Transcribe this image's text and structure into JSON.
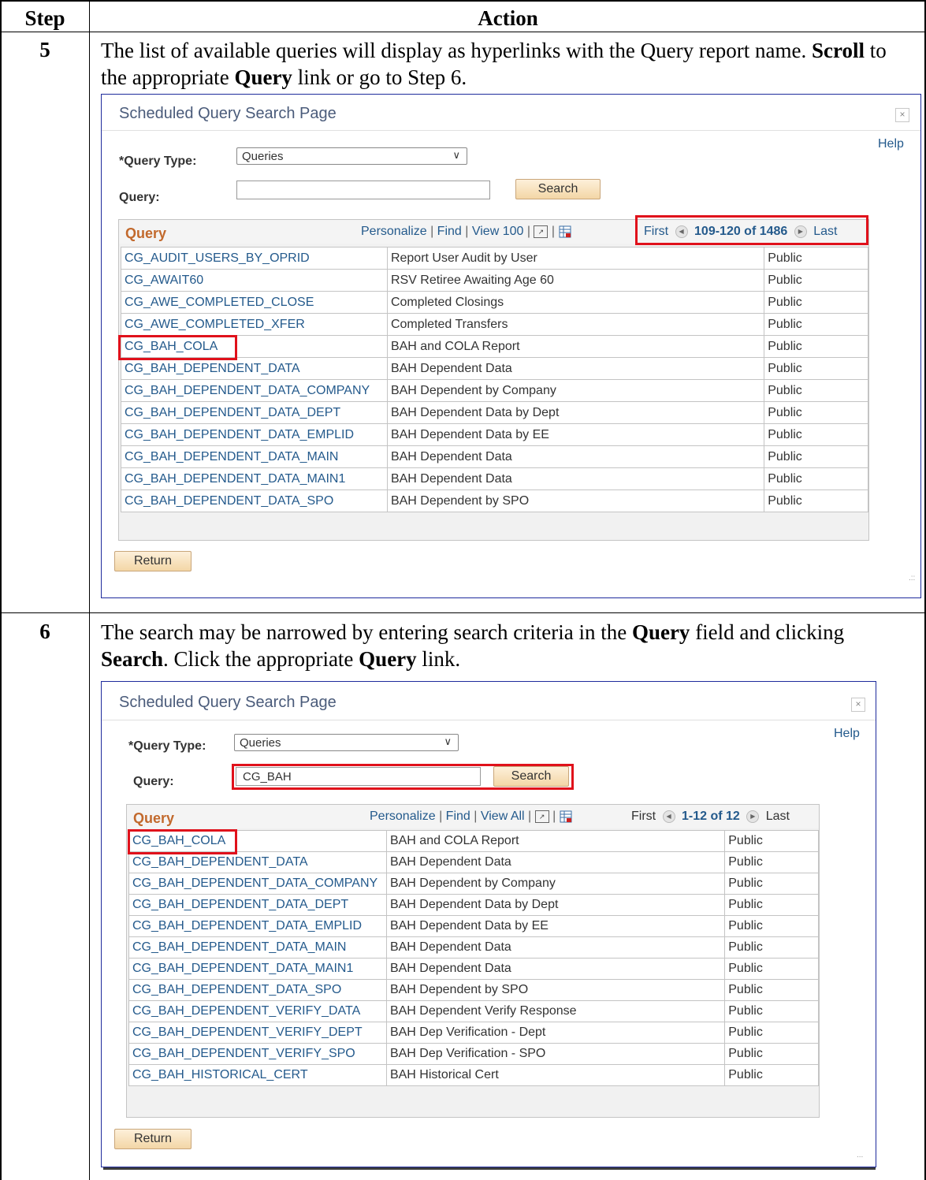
{
  "doc": {
    "header": {
      "step": "Step",
      "action": "Action"
    },
    "steps": [
      {
        "number": "5",
        "text_html": "The list of available queries will display as hyperlinks with the Query report name. <b>Scroll</b> to the appropriate <b>Query</b> link or go to Step 6."
      },
      {
        "number": "6",
        "text_html": "The search may be narrowed by entering search criteria in the <b>Query</b> field and clicking <b>Search</b>. Click the appropriate <b>Query</b> link."
      }
    ]
  },
  "dialog1": {
    "title": "Scheduled Query Search Page",
    "help": "Help",
    "query_type_label": "*Query Type:",
    "query_type_value": "Queries",
    "query_label": "Query:",
    "query_value": "",
    "search_button": "Search",
    "grid_title": "Query",
    "personalize": "Personalize",
    "find": "Find",
    "view": "View 100",
    "nav_first": "First",
    "nav_range": "109-120 of 1486",
    "nav_last": "Last",
    "return_button": "Return",
    "rows": [
      [
        "CG_AUDIT_USERS_BY_OPRID",
        "Report User Audit by User",
        "Public"
      ],
      [
        "CG_AWAIT60",
        "RSV Retiree Awaiting Age 60",
        "Public"
      ],
      [
        "CG_AWE_COMPLETED_CLOSE",
        "Completed Closings",
        "Public"
      ],
      [
        "CG_AWE_COMPLETED_XFER",
        "Completed Transfers",
        "Public"
      ],
      [
        "CG_BAH_COLA",
        "BAH and COLA Report",
        "Public"
      ],
      [
        "CG_BAH_DEPENDENT_DATA",
        "BAH Dependent Data",
        "Public"
      ],
      [
        "CG_BAH_DEPENDENT_DATA_COMPANY",
        "BAH Dependent by Company",
        "Public"
      ],
      [
        "CG_BAH_DEPENDENT_DATA_DEPT",
        "BAH Dependent Data by Dept",
        "Public"
      ],
      [
        "CG_BAH_DEPENDENT_DATA_EMPLID",
        "BAH Dependent Data by EE",
        "Public"
      ],
      [
        "CG_BAH_DEPENDENT_DATA_MAIN",
        "BAH Dependent Data",
        "Public"
      ],
      [
        "CG_BAH_DEPENDENT_DATA_MAIN1",
        "BAH Dependent Data",
        "Public"
      ],
      [
        "CG_BAH_DEPENDENT_DATA_SPO",
        "BAH Dependent by SPO",
        "Public"
      ]
    ]
  },
  "dialog2": {
    "title": "Scheduled Query Search Page",
    "help": "Help",
    "query_type_label": "*Query Type:",
    "query_type_value": "Queries",
    "query_label": "Query:",
    "query_value": "CG_BAH",
    "search_button": "Search",
    "grid_title": "Query",
    "personalize": "Personalize",
    "find": "Find",
    "view": "View All",
    "nav_first": "First",
    "nav_range": "1-12 of 12",
    "nav_last": "Last",
    "return_button": "Return",
    "rows": [
      [
        "CG_BAH_COLA",
        "BAH and COLA Report",
        "Public"
      ],
      [
        "CG_BAH_DEPENDENT_DATA",
        "BAH Dependent Data",
        "Public"
      ],
      [
        "CG_BAH_DEPENDENT_DATA_COMPANY",
        "BAH Dependent by Company",
        "Public"
      ],
      [
        "CG_BAH_DEPENDENT_DATA_DEPT",
        "BAH Dependent Data by Dept",
        "Public"
      ],
      [
        "CG_BAH_DEPENDENT_DATA_EMPLID",
        "BAH Dependent Data by EE",
        "Public"
      ],
      [
        "CG_BAH_DEPENDENT_DATA_MAIN",
        "BAH Dependent Data",
        "Public"
      ],
      [
        "CG_BAH_DEPENDENT_DATA_MAIN1",
        "BAH Dependent Data",
        "Public"
      ],
      [
        "CG_BAH_DEPENDENT_DATA_SPO",
        "BAH Dependent by SPO",
        "Public"
      ],
      [
        "CG_BAH_DEPENDENT_VERIFY_DATA",
        "BAH Dependent Verify Response",
        "Public"
      ],
      [
        "CG_BAH_DEPENDENT_VERIFY_DEPT",
        "BAH Dep Verification - Dept",
        "Public"
      ],
      [
        "CG_BAH_DEPENDENT_VERIFY_SPO",
        "BAH Dep Verification - SPO",
        "Public"
      ],
      [
        "CG_BAH_HISTORICAL_CERT",
        "BAH Historical Cert",
        "Public"
      ]
    ]
  },
  "colors": {
    "link": "#245a8c",
    "highlight": "#e0111b",
    "grid_title": "#c2692c"
  }
}
